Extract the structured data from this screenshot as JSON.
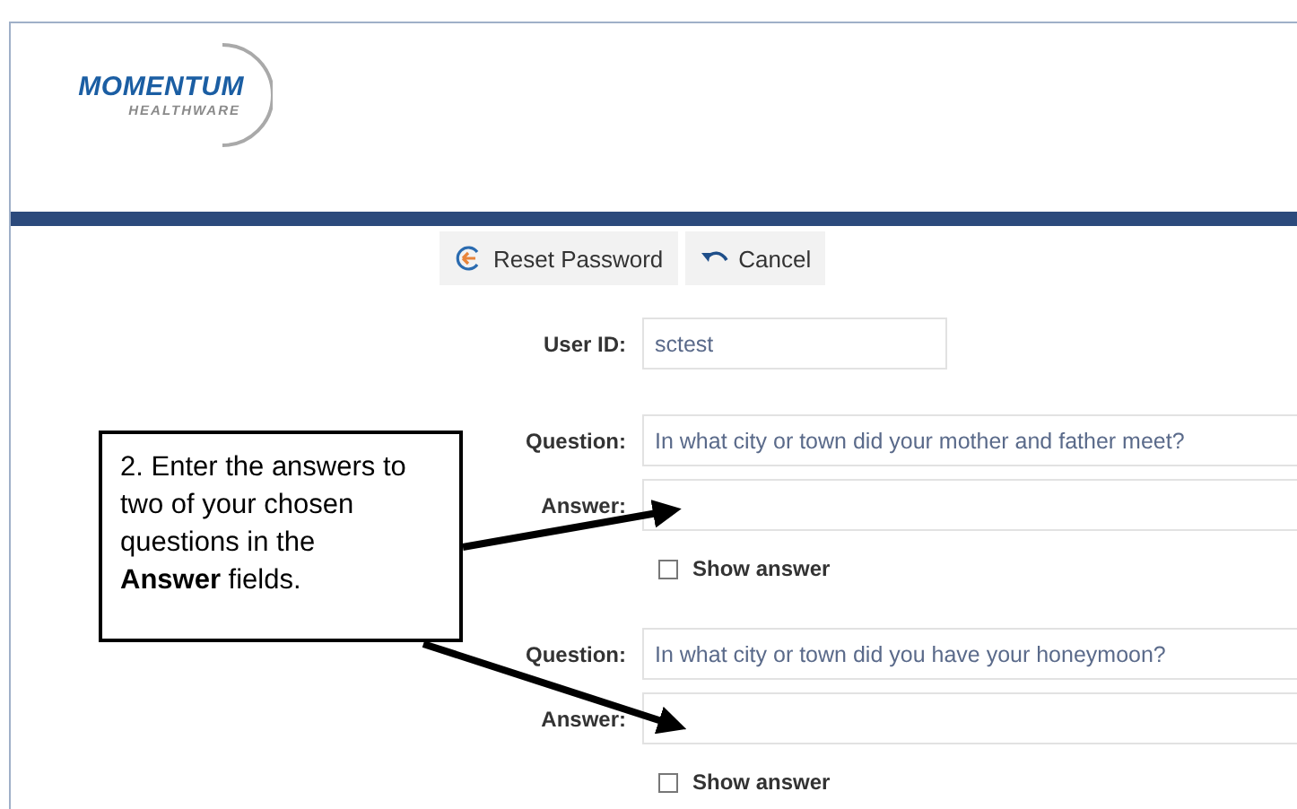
{
  "logo": {
    "name": "MOMENTUM",
    "tagline": "HEALTHWARE"
  },
  "toolbar": [
    {
      "label": "Reset Password",
      "kind": "reset"
    },
    {
      "label": "Cancel",
      "kind": "undo"
    }
  ],
  "user_id": {
    "label": "User ID:",
    "value": "sctest"
  },
  "questions": [
    {
      "question_label": "Question:",
      "question": "In what city or town did your mother and father meet?",
      "answer_label": "Answer:",
      "show_answer": {
        "label": "Show answer",
        "checked": false
      }
    },
    {
      "question_label": "Question:",
      "question": "In what city or town did you have your honeymoon?",
      "answer_label": "Answer:",
      "show_answer": {
        "label": "Show answer",
        "checked": false
      }
    }
  ],
  "callout": {
    "text": "2. Enter the answers to two of your chosen questions in the **Answer** fields."
  }
}
